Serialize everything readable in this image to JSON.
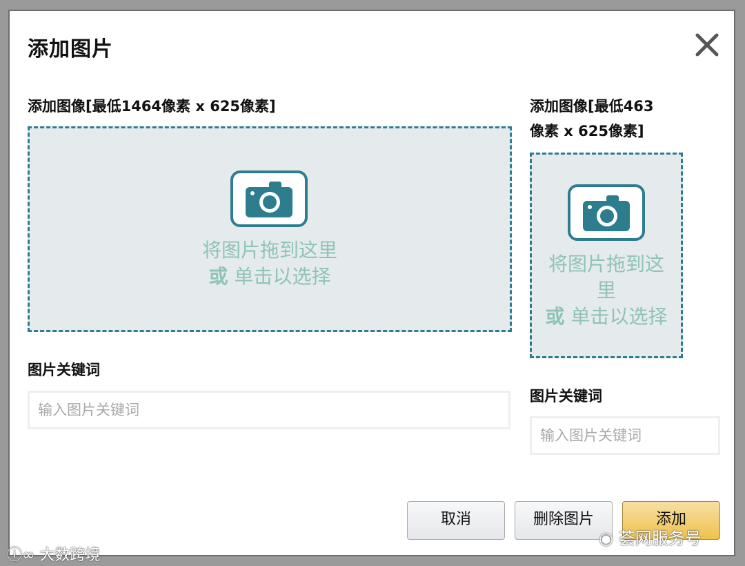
{
  "dialog": {
    "title": "添加图片",
    "close_icon": "close-icon"
  },
  "large": {
    "label": "添加图像[最低1464像素 x 625像素]",
    "drop_line1": "将图片拖到这里",
    "drop_or": "或",
    "drop_line2": "单击以选择",
    "keywords_label": "图片关键词",
    "keywords_placeholder": "输入图片关键词",
    "keywords_value": ""
  },
  "small": {
    "label_line1": "添加图像[最低463",
    "label_line2": "像素 x 625像素]",
    "drop_line1a": "将图片拖到这",
    "drop_line1b": "里",
    "drop_or": "或",
    "drop_line2": "单击以选择",
    "keywords_label": "图片关键词",
    "keywords_placeholder": "输入图片关键词",
    "keywords_value": ""
  },
  "buttons": {
    "cancel": "取消",
    "delete": "删除图片",
    "add": "添加"
  },
  "watermarks": {
    "left": "大数跨境",
    "right": "荟网服务号"
  },
  "colors": {
    "accent": "#2e7d8f",
    "drop_bg": "#e5ebed",
    "drop_text": "#8fc3b7",
    "primary_button": "#f0c14b"
  }
}
